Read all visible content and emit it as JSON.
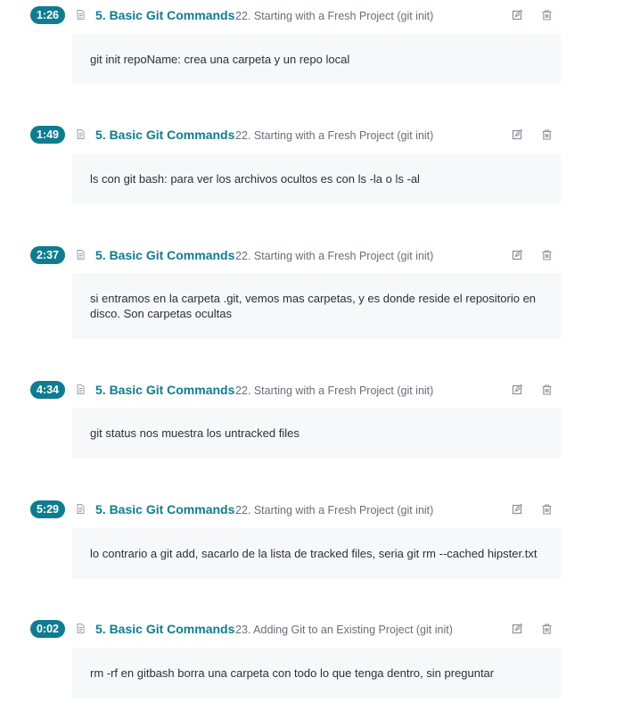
{
  "notes": [
    {
      "time": "1:26",
      "section": "5. Basic Git Commands",
      "lecture": "22. Starting with a Fresh Project (git init)",
      "text": "git init repoName: crea una carpeta y un repo local"
    },
    {
      "time": "1:49",
      "section": "5. Basic Git Commands",
      "lecture": "22. Starting with a Fresh Project (git init)",
      "text": "ls con git bash: para ver los archivos ocultos es con ls -la o ls -al"
    },
    {
      "time": "2:37",
      "section": "5. Basic Git Commands",
      "lecture": "22. Starting with a Fresh Project (git init)",
      "text": "si entramos en la carpeta .git, vemos mas carpetas, y es donde reside el repositorio en disco. Son carpetas ocultas"
    },
    {
      "time": "4:34",
      "section": "5. Basic Git Commands",
      "lecture": "22. Starting with a Fresh Project (git init)",
      "text": "git status nos muestra los untracked files"
    },
    {
      "time": "5:29",
      "section": "5. Basic Git Commands",
      "lecture": "22. Starting with a Fresh Project (git init)",
      "text": "lo contrario a git add, sacarlo de la lista de tracked files, seria git rm --cached hipster.txt"
    },
    {
      "time": "0:02",
      "section": "5. Basic Git Commands",
      "lecture": "23. Adding Git to an Existing Project (git init)",
      "text": "rm -rf en gitbash borra una carpeta con todo lo que tenga dentro, sin preguntar"
    }
  ],
  "icons": {
    "lecture": "document-icon",
    "edit": "edit-icon",
    "delete": "trash-icon"
  },
  "colors": {
    "accent": "#0f7c90",
    "note_background": "#f7f8fa",
    "muted_text": "#686f7a",
    "icon_gray": "#8a929c"
  }
}
